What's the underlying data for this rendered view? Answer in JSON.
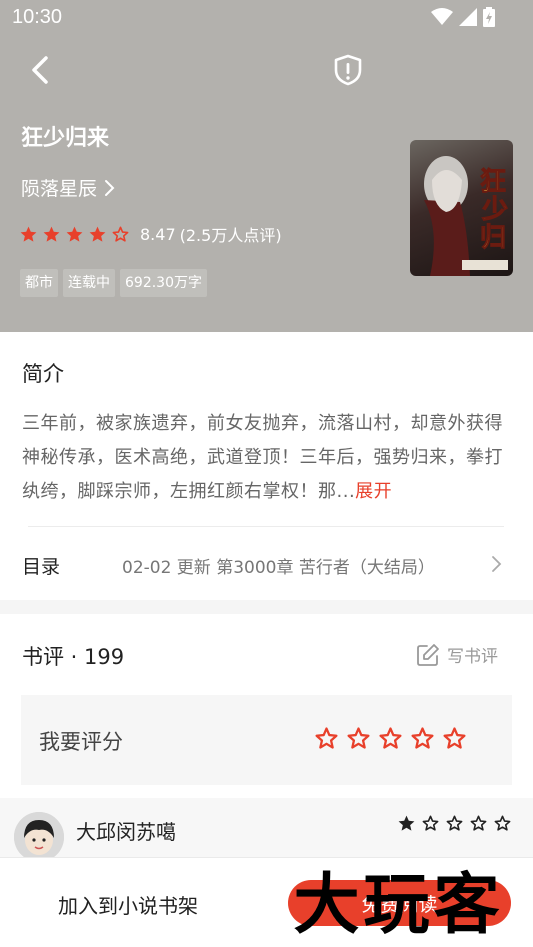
{
  "status_bar": {
    "time": "10:30",
    "icons": [
      "wifi-icon",
      "signal-icon",
      "battery-charging-icon"
    ]
  },
  "header": {
    "back_icon": "back-arrow-icon",
    "report_icon": "shield-exclamation-icon"
  },
  "book": {
    "title": "狂少归来",
    "author": "陨落星辰",
    "rating": 8.47,
    "rating_stars": 4,
    "rating_text": "8.47",
    "rating_count_text": "(2.5万人点评)",
    "tags": [
      "都市",
      "连载中",
      "692.30万字"
    ],
    "cover_icon": "book-cover-image"
  },
  "intro": {
    "heading": "简介",
    "text": "三年前，被家族遗弃，前女友抛弃，流落山村，却意外获得神秘传承，医术高绝，武道登顶！三年后，强势归来，拳打纨绔，脚踩宗师，左拥红颜右掌权！那...",
    "expand_label": "展开"
  },
  "catalog": {
    "label": "目录",
    "latest": "02-02  更新  第3000章 苦行者（大结局）"
  },
  "reviews": {
    "heading": "书评 · 199",
    "write_label": "写书评",
    "my_rating_label": "我要评分",
    "items": [
      {
        "name": "大邱闵苏噶",
        "stars": 1
      }
    ]
  },
  "bottom_bar": {
    "shelf_label": "加入到小说书架",
    "read_label": "免费阅读"
  },
  "watermark": {
    "text": "大玩客"
  },
  "colors": {
    "accent": "#e8402b",
    "hero_bg": "#b3b1ad",
    "star_red": "#e8402b"
  }
}
